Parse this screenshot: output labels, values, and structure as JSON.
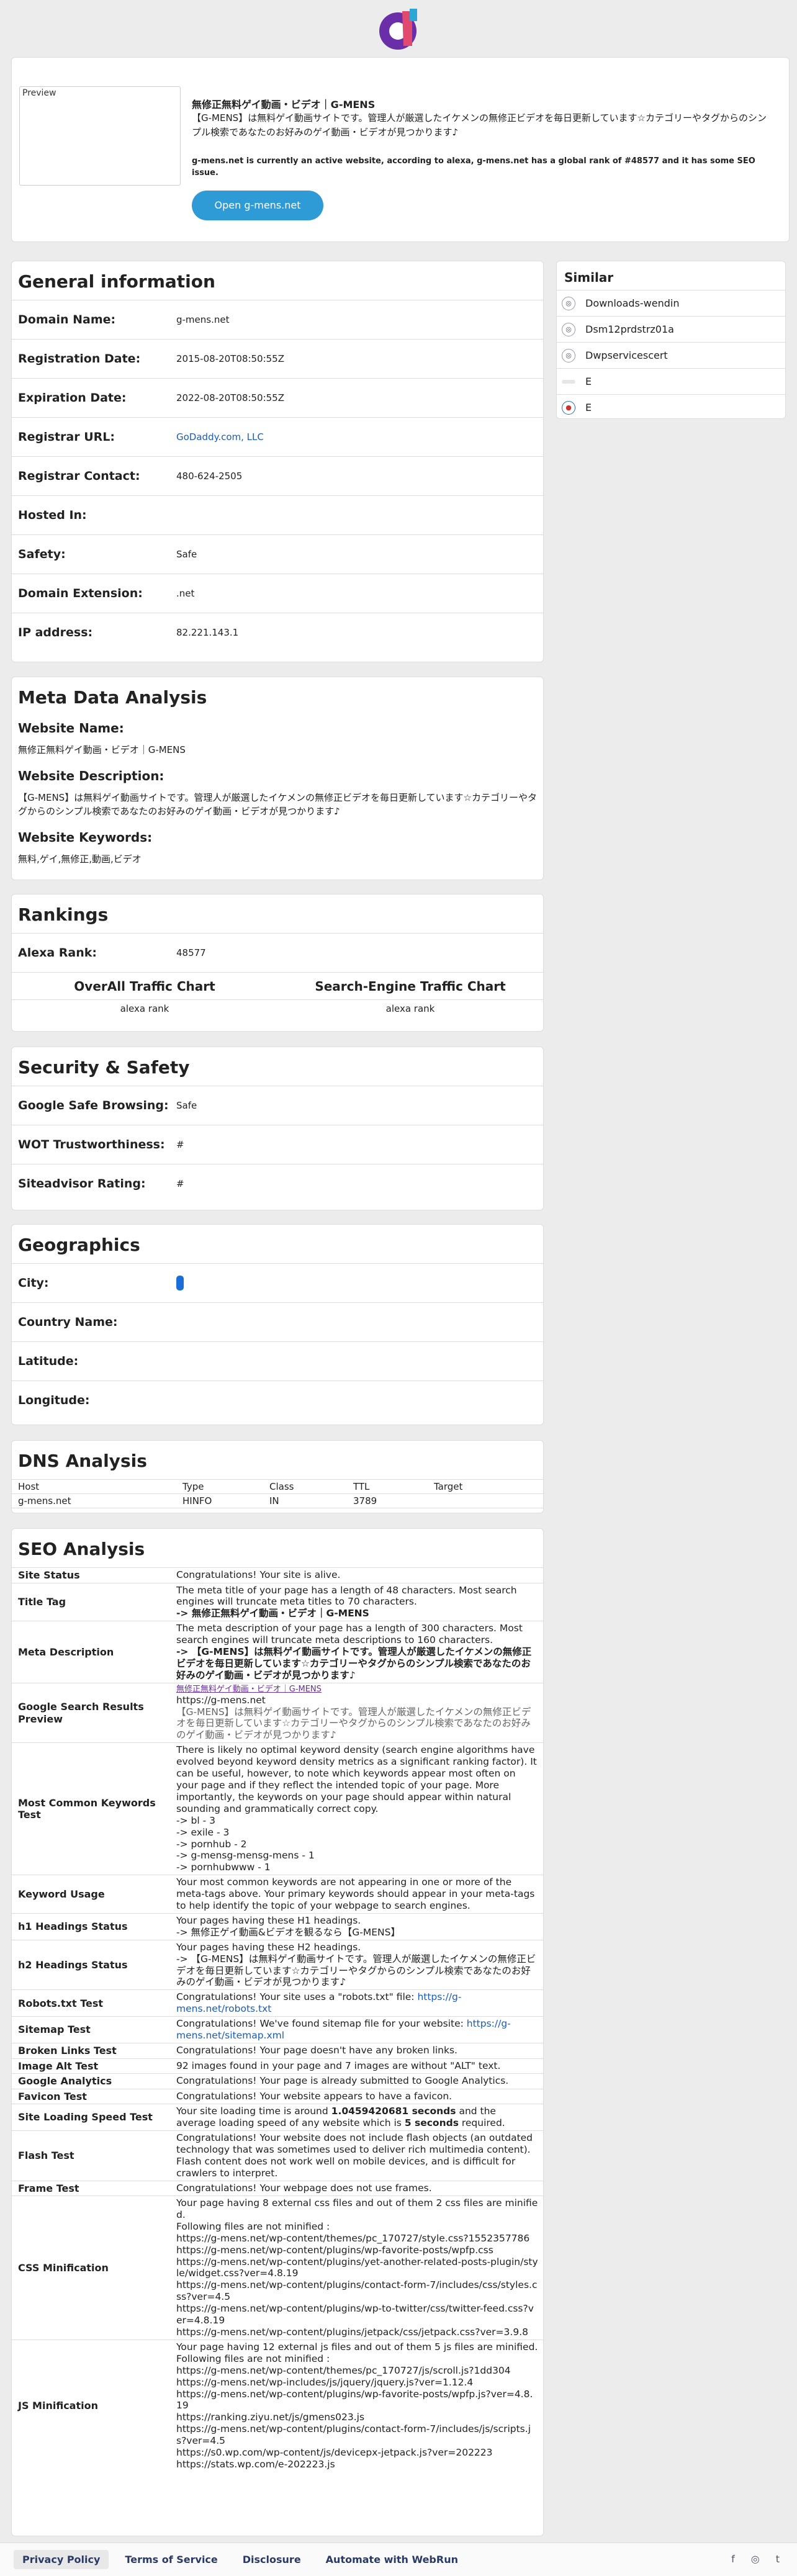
{
  "hero": {
    "preview_alt": "Preview",
    "title": "無修正無料ゲイ動画・ビデオ｜G-MENS",
    "description": "【G-MENS】は無料ゲイ動画サイトです。管理人が厳選したイケメンの無修正ビデオを毎日更新しています☆カテゴリーやタグからのシンプル検索であなたのお好みのゲイ動画・ビデオが見つかります♪",
    "note": "g-mens.net is currently an active website, according to alexa, g-mens.net has a global rank of #48577 and it has some SEO issue.",
    "open_button": "Open g-mens.net"
  },
  "general": {
    "title": "General information",
    "rows": [
      {
        "k": "Domain Name:",
        "v": "g-mens.net"
      },
      {
        "k": "Registration Date:",
        "v": "2015-08-20T08:50:55Z"
      },
      {
        "k": "Expiration Date:",
        "v": "2022-08-20T08:50:55Z"
      },
      {
        "k": "Registrar URL:",
        "v": "GoDaddy.com, LLC"
      },
      {
        "k": "Registrar Contact:",
        "v": "480-624-2505"
      },
      {
        "k": "Hosted In:",
        "v": ""
      },
      {
        "k": "Safety:",
        "v": "Safe"
      },
      {
        "k": "Domain Extension:",
        "v": ".net"
      },
      {
        "k": "IP address:",
        "v": "82.221.143.1"
      }
    ]
  },
  "similar": {
    "title": "Similar",
    "items": [
      "Downloads-wendin",
      "Dsm12prdstrz01a",
      "Dwpservicescert",
      "E",
      "E"
    ]
  },
  "meta": {
    "title": "Meta Data Analysis",
    "name_label": "Website Name:",
    "name": "無修正無料ゲイ動画・ビデオ｜G-MENS",
    "desc_label": "Website Description:",
    "desc": "【G-MENS】は無料ゲイ動画サイトです。管理人が厳選したイケメンの無修正ビデオを毎日更新しています☆カテゴリーやタグからのシンプル検索であなたのお好みのゲイ動画・ビデオが見つかります♪",
    "kw_label": "Website Keywords:",
    "kw": "無料,ゲイ,無修正,動画,ビデオ"
  },
  "rankings": {
    "title": "Rankings",
    "alexa_label": "Alexa Rank:",
    "alexa": "48577",
    "overall": "OverAll Traffic Chart",
    "se": "Search-Engine Traffic Chart",
    "alt1": "alexa rank",
    "alt2": "alexa rank"
  },
  "security": {
    "title": "Security & Safety",
    "rows": [
      {
        "k": "Google Safe Browsing:",
        "v": "Safe"
      },
      {
        "k": "WOT Trustworthiness:",
        "v": "#"
      },
      {
        "k": "Siteadvisor Rating:",
        "v": "#"
      }
    ]
  },
  "geo": {
    "title": "Geographics",
    "rows": [
      {
        "k": "City:",
        "v": ""
      },
      {
        "k": "Country Name:",
        "v": ""
      },
      {
        "k": "Latitude:",
        "v": ""
      },
      {
        "k": "Longitude:",
        "v": ""
      }
    ]
  },
  "dns": {
    "title": "DNS Analysis",
    "headers": [
      "Host",
      "Type",
      "Class",
      "TTL",
      "Target"
    ],
    "row": [
      "g-mens.net",
      "HINFO",
      "IN",
      "3789",
      ""
    ]
  },
  "seo": {
    "title": "SEO Analysis",
    "site_status_k": "Site Status",
    "site_status_v": "Congratulations! Your site is alive.",
    "title_tag_k": "Title Tag",
    "title_tag_v": "The meta title of your page has a length of 48 characters. Most search engines will truncate meta titles to 70 characters.",
    "title_tag_b": "-> 無修正無料ゲイ動画・ビデオ｜G-MENS",
    "meta_desc_k": "Meta Description",
    "meta_desc_v": "The meta description of your page has a length of 300 characters. Most search engines will truncate meta descriptions to 160 characters.",
    "meta_desc_b": "-> 【G-MENS】は無料ゲイ動画サイトです。管理人が厳選したイケメンの無修正ビデオを毎日更新しています☆カテゴリーやタグからのシンプル検索であなたのお好みのゲイ動画・ビデオが見つかります♪",
    "gsr_k": "Google Search Results Preview",
    "gsr_title": "無修正無料ゲイ動画・ビデオ｜G-MENS",
    "gsr_url": "https://g-mens.net",
    "gsr_desc": "【G-MENS】は無料ゲイ動画サイトです。管理人が厳選したイケメンの無修正ビデオを毎日更新しています☆カテゴリーやタグからのシンプル検索であなたのお好みのゲイ動画・ビデオが見つかります♪",
    "mck_k": "Most Common Keywords Test",
    "mck_v": "There is likely no optimal keyword density (search engine algorithms have evolved beyond keyword density metrics as a significant ranking factor). It can be useful, however, to note which keywords appear most often on your page and if they reflect the intended topic of your page. More importantly, the keywords on your page should appear within natural sounding and grammatically correct copy.\n-> bl - 3\n-> exile - 3\n-> pornhub - 2\n-> g-mensg-mensg-mens - 1\n-> pornhubwww - 1",
    "ku_k": "Keyword Usage",
    "ku_v": "Your most common keywords are not appearing in one or more of the meta-tags above. Your primary keywords should appear in your meta-tags to help identify the topic of your webpage to search engines.",
    "h1_k": "h1 Headings Status",
    "h1_v": "Your pages having these H1 headings.\n-> 無修正ゲイ動画&ビデオを観るなら【G-MENS】",
    "h2_k": "h2 Headings Status",
    "h2_v": "Your pages having these H2 headings.\n-> 【G-MENS】は無料ゲイ動画サイトです。管理人が厳選したイケメンの無修正ビデオを毎日更新しています☆カテゴリーやタグからのシンプル検索であなたのお好みのゲイ動画・ビデオが見つかります♪",
    "robots_k": "Robots.txt Test",
    "robots_v": "Congratulations! Your site uses a \"robots.txt\" file: ",
    "robots_link": "https://g-mens.net/robots.txt",
    "sitemap_k": "Sitemap Test",
    "sitemap_v": "Congratulations! We've found sitemap file for your website: ",
    "sitemap_link": "https://g-mens.net/sitemap.xml",
    "broken_k": "Broken Links Test",
    "broken_v": "Congratulations! Your page doesn't have any broken links.",
    "alt_k": "Image Alt Test",
    "alt_v": "92 images found in your page and 7 images are without \"ALT\" text.",
    "ga_k": "Google Analytics",
    "ga_v": "Congratulations! Your page is already submitted to Google Analytics.",
    "fav_k": "Favicon Test",
    "fav_v": "Congratulations! Your website appears to have a favicon.",
    "speed_k": "Site Loading Speed Test",
    "speed_a": "Your site loading time is around ",
    "speed_b": "1.0459420681 seconds",
    "speed_c": " and the average loading speed of any website which is ",
    "speed_d": "5 seconds",
    "speed_e": " required.",
    "flash_k": "Flash Test",
    "flash_v": "Congratulations! Your website does not include flash objects (an outdated technology that was sometimes used to deliver rich multimedia content). Flash content does not work well on mobile devices, and is difficult for crawlers to interpret.",
    "frame_k": "Frame Test",
    "frame_v": "Congratulations! Your webpage does not use frames.",
    "css_k": "CSS Minification",
    "css_v": "Your page having 8 external css files and out of them 2 css files are minified.\nFollowing files are not minified :\nhttps://g-mens.net/wp-content/themes/pc_170727/style.css?1552357786\nhttps://g-mens.net/wp-content/plugins/wp-favorite-posts/wpfp.css\nhttps://g-mens.net/wp-content/plugins/yet-another-related-posts-plugin/style/widget.css?ver=4.8.19\nhttps://g-mens.net/wp-content/plugins/contact-form-7/includes/css/styles.css?ver=4.5\nhttps://g-mens.net/wp-content/plugins/wp-to-twitter/css/twitter-feed.css?ver=4.8.19\nhttps://g-mens.net/wp-content/plugins/jetpack/css/jetpack.css?ver=3.9.8",
    "js_k": "JS Minification",
    "js_v": "Your page having 12 external js files and out of them 5 js files are minified.\nFollowing files are not minified :\nhttps://g-mens.net/wp-content/themes/pc_170727/js/scroll.js?1dd304\nhttps://g-mens.net/wp-includes/js/jquery/jquery.js?ver=1.12.4\nhttps://g-mens.net/wp-content/plugins/wp-favorite-posts/wpfp.js?ver=4.8.19\nhttps://ranking.ziyu.net/js/gmens023.js\nhttps://g-mens.net/wp-content/plugins/contact-form-7/includes/js/scripts.js?ver=4.5\nhttps://s0.wp.com/wp-content/js/devicepx-jetpack.js?ver=202223\nhttps://stats.wp.com/e-202223.js"
  },
  "footer": {
    "links": [
      "Privacy Policy",
      "Terms of Service",
      "Disclosure",
      "Automate with WebRun"
    ],
    "social": [
      "f",
      "◎",
      "t"
    ]
  }
}
